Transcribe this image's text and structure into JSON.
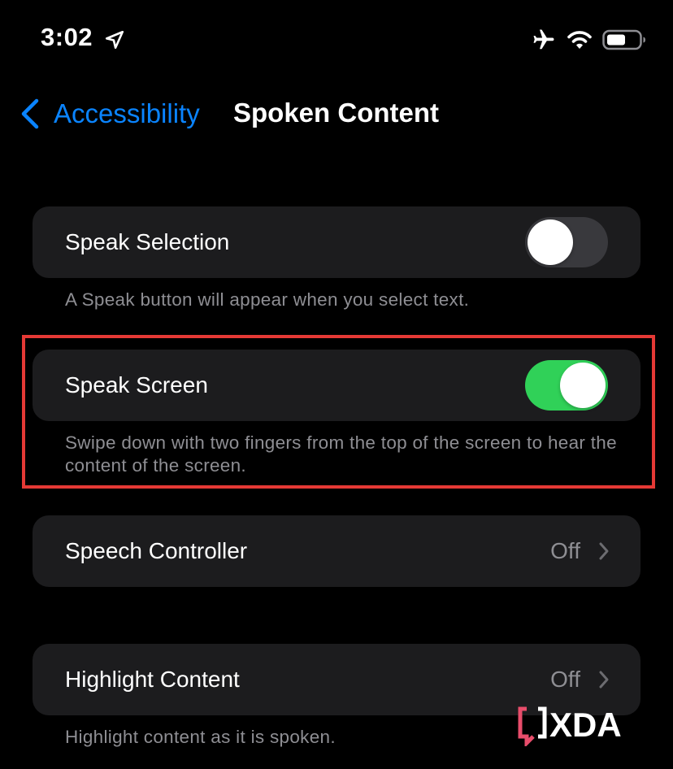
{
  "status_bar": {
    "time": "3:02",
    "icons": [
      "location-arrow-icon",
      "airplane-mode-icon",
      "wifi-icon",
      "battery-icon"
    ]
  },
  "nav": {
    "back_label": "Accessibility",
    "title": "Spoken Content"
  },
  "settings": {
    "speak_selection": {
      "label": "Speak Selection",
      "toggle_on": false,
      "footnote": "A Speak button will appear when you select text."
    },
    "speak_screen": {
      "label": "Speak Screen",
      "toggle_on": true,
      "footnote": "Swipe down with two fingers from the top of the screen to hear the content of the screen."
    },
    "speech_controller": {
      "label": "Speech Controller",
      "value": "Off"
    },
    "highlight_content": {
      "label": "Highlight Content",
      "value": "Off",
      "footnote": "Highlight content as it is spoken."
    }
  },
  "watermark": {
    "text": "XDA"
  },
  "colors": {
    "background": "#000000",
    "cell_background": "#1C1C1E",
    "accent_blue": "#0A84FF",
    "toggle_on": "#30D158",
    "toggle_off": "#39393D",
    "secondary_text": "#8E8E93",
    "highlight_border": "#E53935"
  }
}
